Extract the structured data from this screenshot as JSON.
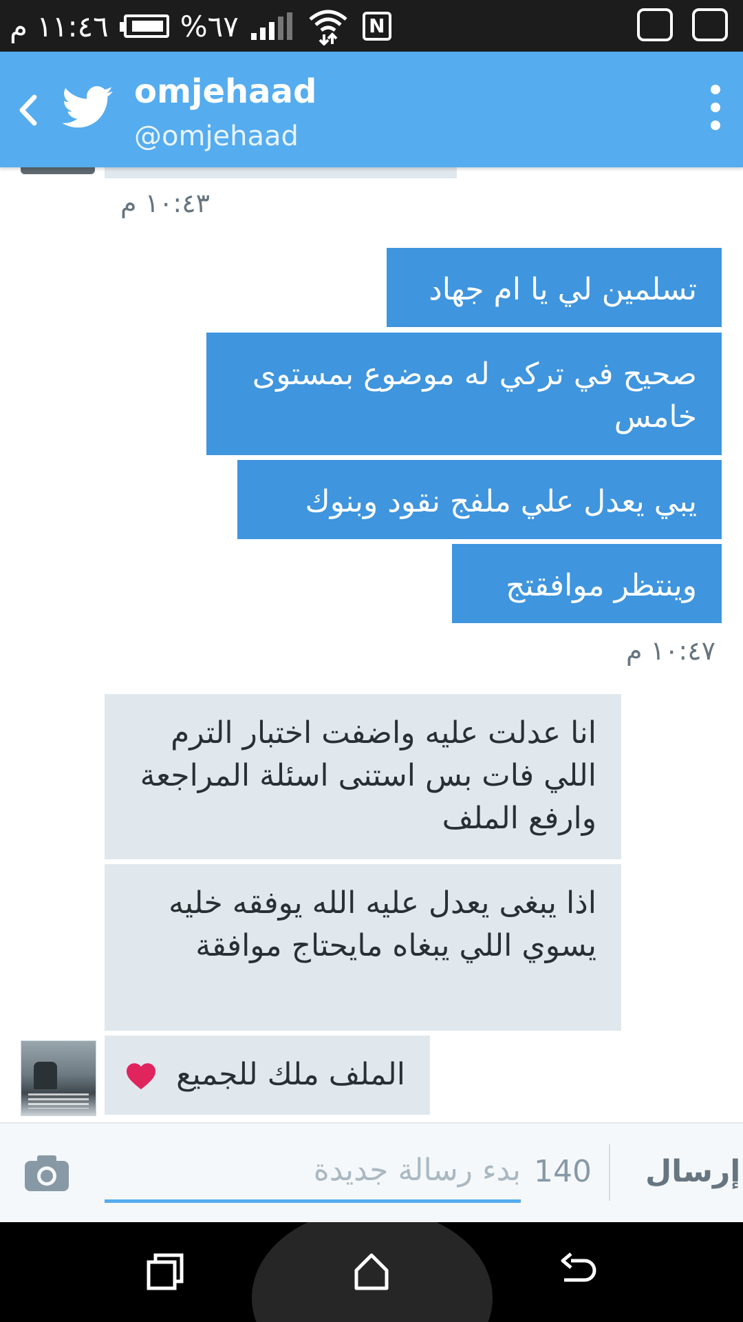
{
  "status_bar": {
    "time": "١١:٤٦ م",
    "battery": "%٦٧"
  },
  "header": {
    "name": "omjehaad",
    "handle": "@omjehaad"
  },
  "messages": {
    "ts_1": "١٠:٤٣ م",
    "out": [
      "تسلمين لي يا ام جهاد",
      "صحيح في تركي له موضوع بمستوى خامس",
      "يبي يعدل علي ملفج نقود وبنوك",
      "وينتظر موافقتج"
    ],
    "ts_2": "١٠:٤٧ م",
    "in": [
      "انا عدلت عليه واضفت اختبار الترم اللي فات بس استنى اسئلة المراجعة وارفع الملف",
      "اذا يبغى يعدل عليه الله يوفقه خليه يسوي اللي يبغاه مايحتاج موافقة",
      "الملف ملك للجميع"
    ]
  },
  "composer": {
    "placeholder": "بدء رسالة جديدة",
    "counter": "140",
    "send_label": "إرسال"
  },
  "colors": {
    "app_bar": "#55acee",
    "outgoing_bubble": "#3f95de",
    "incoming_bubble": "#e1e8ed",
    "heart": "#e0245e"
  },
  "icons": [
    "back-icon",
    "twitter-bird-icon",
    "overflow-menu-icon",
    "camera-icon",
    "recent-apps-icon",
    "home-icon",
    "back-nav-icon",
    "heart-icon"
  ]
}
